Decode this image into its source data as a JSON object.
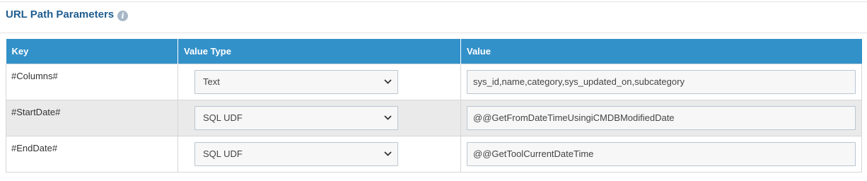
{
  "section": {
    "title": "URL Path Parameters",
    "info_icon": "info-icon"
  },
  "table": {
    "headers": [
      "Key",
      "Value Type",
      "Value"
    ],
    "rows": [
      {
        "key": "#Columns#",
        "value_type": "Text",
        "value": "sys_id,name,category,sys_updated_on,subcategory"
      },
      {
        "key": "#StartDate#",
        "value_type": "SQL UDF",
        "value": "@@GetFromDateTimeUsingiCMDBModifiedDate"
      },
      {
        "key": "#EndDate#",
        "value_type": "SQL UDF",
        "value": "@@GetToolCurrentDateTime"
      }
    ]
  },
  "colors": {
    "header_bg": "#3391c9",
    "title": "#1f5d8f",
    "alt_row_bg": "#eaeaea"
  }
}
